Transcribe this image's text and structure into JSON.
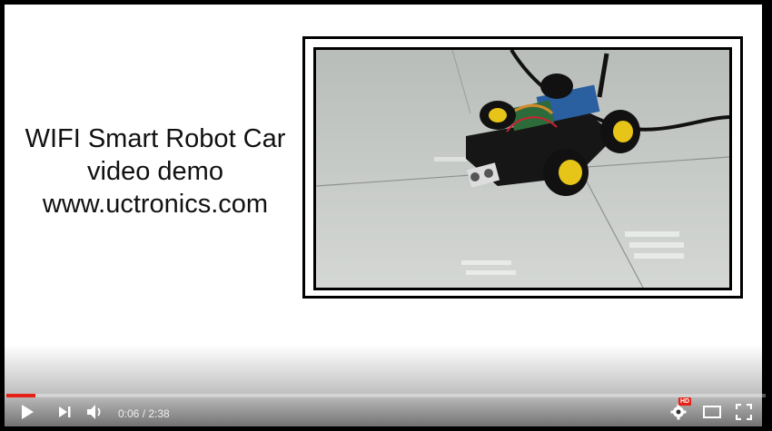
{
  "video": {
    "title_lines": [
      "WIFI Smart Robot Car",
      "video demo",
      "www.uctronics.com"
    ],
    "progress_fraction": 0.038
  },
  "controls": {
    "current_time": "0:06",
    "separator": " / ",
    "duration": "2:38",
    "hd_badge": "HD"
  },
  "icons": {
    "play": "play-icon",
    "next": "next-icon",
    "volume": "volume-icon",
    "settings": "gear-icon",
    "theater": "theater-mode-icon",
    "fullscreen": "fullscreen-icon"
  },
  "colors": {
    "progress_fill": "#e62117",
    "hd_badge": "#e62117"
  }
}
